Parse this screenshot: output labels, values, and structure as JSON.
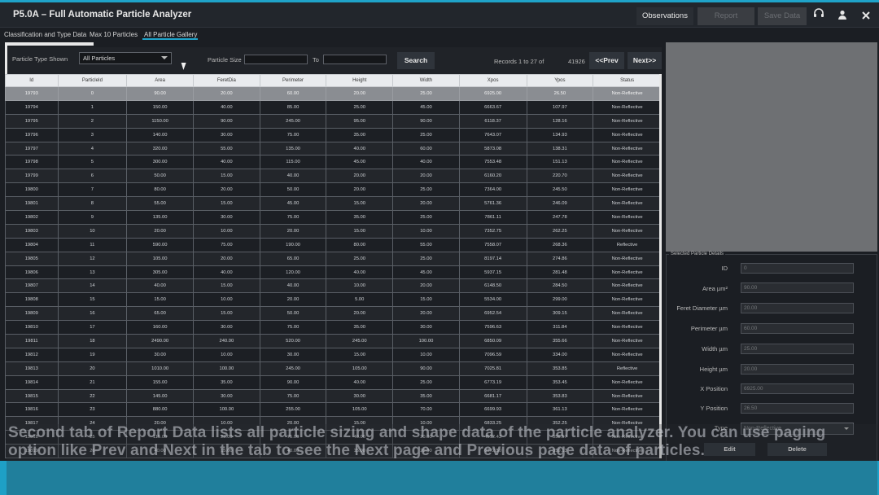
{
  "app": {
    "title": "P5.0A – Full Automatic Particle Analyzer",
    "observations": "Observations",
    "report": "Report",
    "save_data": "Save Data",
    "headset_icon": "headset-icon",
    "user_icon": "user-icon",
    "close_icon": "close-icon"
  },
  "tabs": [
    "Classification and Type Data",
    "Max 10 Particles",
    "All Particle Gallery"
  ],
  "filter": {
    "particle_type_label": "Particle Type Shown",
    "particle_type_value": "All Particles",
    "particle_size_label": "Particle Size",
    "to_label": "To",
    "search": "Search",
    "records": "Records 1 to 27 of",
    "total": "41926",
    "prev": "<<Prev",
    "next": "Next>>"
  },
  "columns": [
    "Id",
    "ParticleId",
    "Area",
    "FeretDia",
    "Perimeter",
    "Height",
    "Width",
    "Xpos",
    "Ypos",
    "Status"
  ],
  "rows": [
    [
      "19793",
      "0",
      "90.00",
      "20.00",
      "60.00",
      "20.00",
      "25.00",
      "6925.00",
      "26.50",
      "Non-Reflective"
    ],
    [
      "19794",
      "1",
      "150.00",
      "40.00",
      "85.00",
      "25.00",
      "45.00",
      "6663.67",
      "107.97",
      "Non-Reflective"
    ],
    [
      "19795",
      "2",
      "1150.00",
      "90.00",
      "245.00",
      "95.00",
      "90.00",
      "6118.37",
      "128.16",
      "Non-Reflective"
    ],
    [
      "19796",
      "3",
      "140.00",
      "30.00",
      "75.00",
      "35.00",
      "25.00",
      "7643.07",
      "134.93",
      "Non-Reflective"
    ],
    [
      "19797",
      "4",
      "320.00",
      "55.00",
      "135.00",
      "40.00",
      "60.00",
      "5873.08",
      "138.31",
      "Non-Reflective"
    ],
    [
      "19798",
      "5",
      "300.00",
      "40.00",
      "115.00",
      "45.00",
      "40.00",
      "7553.48",
      "151.13",
      "Non-Reflective"
    ],
    [
      "19799",
      "6",
      "50.00",
      "15.00",
      "40.00",
      "20.00",
      "20.00",
      "6160.20",
      "220.70",
      "Non-Reflective"
    ],
    [
      "19800",
      "7",
      "80.00",
      "20.00",
      "50.00",
      "20.00",
      "25.00",
      "7364.00",
      "245.50",
      "Non-Reflective"
    ],
    [
      "19801",
      "8",
      "55.00",
      "15.00",
      "45.00",
      "15.00",
      "20.00",
      "5761.36",
      "246.09",
      "Non-Reflective"
    ],
    [
      "19802",
      "9",
      "135.00",
      "30.00",
      "75.00",
      "35.00",
      "25.00",
      "7861.11",
      "247.78",
      "Non-Reflective"
    ],
    [
      "19803",
      "10",
      "20.00",
      "10.00",
      "20.00",
      "15.00",
      "10.00",
      "7352.75",
      "262.25",
      "Non-Reflective"
    ],
    [
      "19804",
      "11",
      "590.00",
      "75.00",
      "190.00",
      "80.00",
      "55.00",
      "7558.07",
      "268.36",
      "Reflective"
    ],
    [
      "19805",
      "12",
      "105.00",
      "20.00",
      "65.00",
      "25.00",
      "25.00",
      "8197.14",
      "274.86",
      "Non-Reflective"
    ],
    [
      "19806",
      "13",
      "305.00",
      "40.00",
      "120.00",
      "40.00",
      "45.00",
      "5937.15",
      "281.48",
      "Non-Reflective"
    ],
    [
      "19807",
      "14",
      "40.00",
      "15.00",
      "40.00",
      "10.00",
      "20.00",
      "6148.50",
      "284.50",
      "Non-Reflective"
    ],
    [
      "19808",
      "15",
      "15.00",
      "10.00",
      "20.00",
      "5.00",
      "15.00",
      "5534.00",
      "299.00",
      "Non-Reflective"
    ],
    [
      "19809",
      "16",
      "65.00",
      "15.00",
      "50.00",
      "20.00",
      "20.00",
      "6952.54",
      "309.15",
      "Non-Reflective"
    ],
    [
      "19810",
      "17",
      "160.00",
      "30.00",
      "75.00",
      "35.00",
      "30.00",
      "7596.63",
      "311.84",
      "Non-Reflective"
    ],
    [
      "19811",
      "18",
      "2490.00",
      "240.00",
      "520.00",
      "245.00",
      "100.00",
      "6850.09",
      "355.66",
      "Non-Reflective"
    ],
    [
      "19812",
      "19",
      "30.00",
      "10.00",
      "30.00",
      "15.00",
      "10.00",
      "7096.59",
      "334.00",
      "Non-Reflective"
    ],
    [
      "19813",
      "20",
      "1010.00",
      "100.00",
      "245.00",
      "105.00",
      "90.00",
      "7025.81",
      "353.85",
      "Reflective"
    ],
    [
      "19814",
      "21",
      "155.00",
      "35.00",
      "90.00",
      "40.00",
      "25.00",
      "6773.19",
      "353.45",
      "Non-Reflective"
    ],
    [
      "19815",
      "22",
      "145.00",
      "30.00",
      "75.00",
      "30.00",
      "35.00",
      "6681.17",
      "353.83",
      "Non-Reflective"
    ],
    [
      "19816",
      "23",
      "880.00",
      "100.00",
      "255.00",
      "105.00",
      "70.00",
      "6699.93",
      "361.13",
      "Non-Reflective"
    ],
    [
      "19817",
      "24",
      "20.00",
      "10.00",
      "20.00",
      "15.00",
      "10.00",
      "6833.25",
      "352.25",
      "Non-Reflective"
    ],
    [
      "19818",
      "25",
      "115.00",
      "25.00",
      "75.00",
      "40.00",
      "20.00",
      "4512.43",
      "358.57",
      "Non-Reflective"
    ],
    [
      "19819",
      "26",
      "40.00",
      "15.00",
      "40.00",
      "15.00",
      "20.00",
      "6272.50",
      "359.13",
      "Non-Reflective"
    ]
  ],
  "details": {
    "title": "Selected Particle Details",
    "id_label": "ID",
    "id_value": "0",
    "area_label": "Area µm²",
    "area_value": "90.00",
    "feret_label": "Feret Diameter µm",
    "feret_value": "20.00",
    "perimeter_label": "Perimeter µm",
    "perimeter_value": "60.00",
    "width_label": "Width µm",
    "width_value": "25.00",
    "height_label": "Height µm",
    "height_value": "20.00",
    "xpos_label": "X Position",
    "xpos_value": "6925.00",
    "ypos_label": "Y Position",
    "ypos_value": "26.50",
    "type_label": "Type",
    "type_value": "Non-Reflective",
    "edit": "Edit",
    "delete": "Delete"
  },
  "caption": "Second tab of Report Data lists all particle sizing and shape data of the particle analyzer. You can use paging option like Prev and Next in the tab to see the Next page and Previous page data of particles."
}
